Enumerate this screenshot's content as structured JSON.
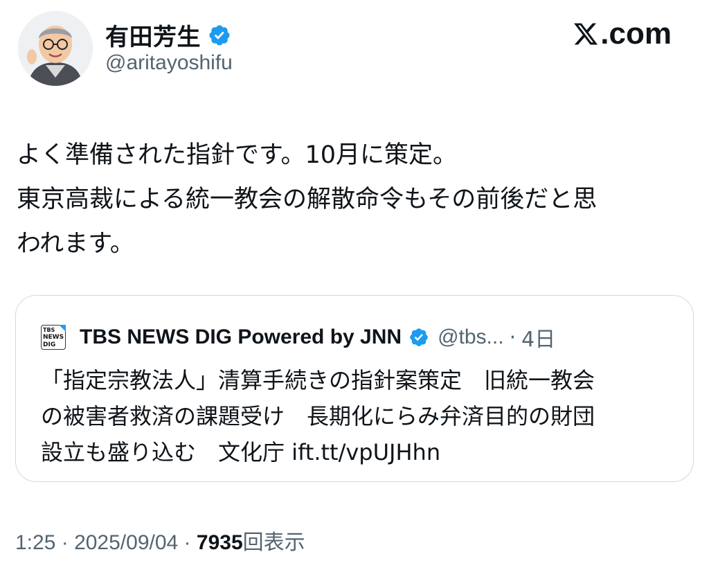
{
  "author": {
    "display_name": "有田芳生",
    "handle": "@aritayoshifu",
    "verified_icon": "verified-badge-icon",
    "avatar_icon": "avatar-illustration"
  },
  "brand": {
    "logo_icon": "x-logo-icon",
    "label": ".com"
  },
  "tweet": {
    "lines": [
      "よく準備された指針です。10月に策定。",
      "東京高裁による統一教会の解散命令もその前後だと思",
      "われます。"
    ]
  },
  "quote": {
    "account_logo_lines": [
      "TBS",
      "NEWS",
      "DIG"
    ],
    "display_name": "TBS NEWS DIG Powered by JNN",
    "handle": "@tbs...",
    "separator": "·",
    "time": "4日",
    "lines": [
      "「指定宗教法人」清算手続きの指針案策定　旧統一教会",
      "の被害者救済の課題受け　長期化にらみ弁済目的の財団",
      "設立も盛り込む　文化庁 ift.tt/vpUJHhn"
    ]
  },
  "meta": {
    "time": "1:25",
    "sep1": " · ",
    "date": "2025/09/04",
    "sep2": " · ",
    "views": "7935",
    "views_label": "回表示"
  },
  "colors": {
    "text": "#0f1419",
    "secondary": "#536471",
    "verified": "#1d9bf0",
    "border": "#cfd9de"
  }
}
